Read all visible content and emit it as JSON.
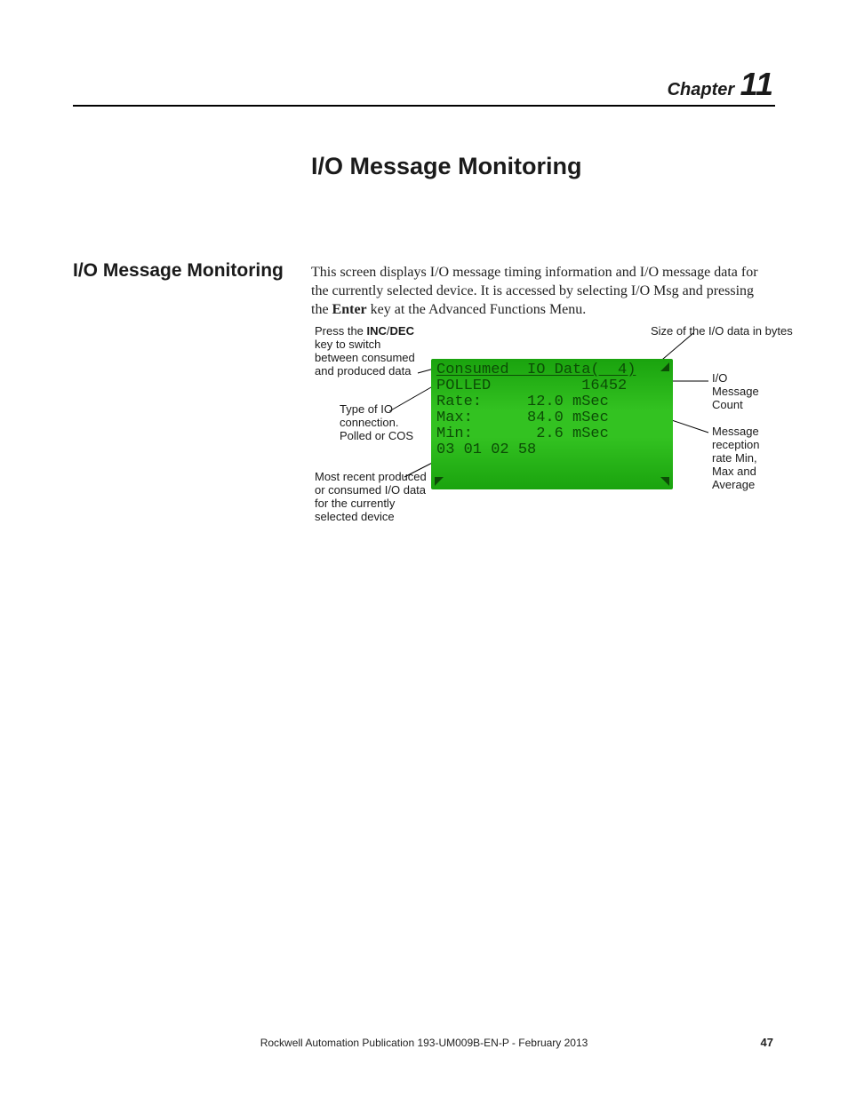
{
  "header": {
    "chapter_word": "Chapter",
    "chapter_number": "11"
  },
  "title": "I/O Message Monitoring",
  "section_heading": "I/O Message Monitoring",
  "body": {
    "before_enter": "This screen displays I/O message timing information and I/O message data for the currently selected device. It is accessed by selecting I/O Msg and pressing the ",
    "enter": "Enter",
    "after_enter": " key at the Advanced Functions Menu."
  },
  "lcd": {
    "line1": "Consumed  IO Data(  4)",
    "line2": "POLLED          16452",
    "line3": "Rate:     12.0 mSec",
    "line4": "Max:      84.0 mSec",
    "line5": "Min:       2.6 mSec",
    "line6": "03 01 02 58"
  },
  "callouts": {
    "top_left_pre": "Press the ",
    "top_left_inc": "INC",
    "top_left_slash": "/",
    "top_left_dec": "DEC",
    "top_left_post": " key to switch between consumed and produced data",
    "mid_left": "Type of IO connection. Polled or COS",
    "bottom_left": "Most recent produced or consumed I/O data for the currently selected device",
    "top_right": "Size of the I/O data in bytes",
    "right_upper": "I/O Message Count",
    "right_lower": "Message reception rate Min, Max and Average"
  },
  "footer": {
    "publication": "Rockwell Automation Publication 193-UM009B-EN-P - February 2013",
    "page": "47"
  }
}
